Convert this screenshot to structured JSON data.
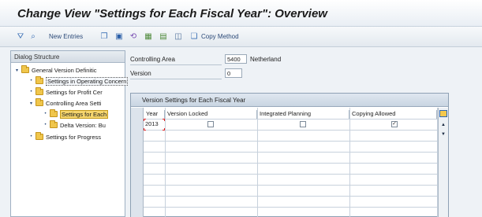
{
  "window": {
    "title": "Change View \"Settings for Each Fiscal Year\": Overview"
  },
  "toolbar": {
    "icons": [
      "filter-icon",
      "display-change-icon"
    ],
    "new_entries": "New Entries",
    "actions": [
      "copy-icon",
      "save-icon",
      "undo-icon",
      "select-all-icon",
      "select-block-icon",
      "deselect-icon"
    ],
    "copy_method": "Copy Method"
  },
  "dialog_structure": {
    "title": "Dialog Structure",
    "items": [
      {
        "label": "General Version Definitic",
        "level": 0,
        "expander": "▾"
      },
      {
        "label": "Settings in Operating Concern",
        "level": 1,
        "expander": "•"
      },
      {
        "label": "Settings for Profit Cer",
        "level": 1,
        "expander": "•"
      },
      {
        "label": "Controlling Area Setti",
        "level": 1,
        "expander": "▾"
      },
      {
        "label": "Settings for Each",
        "level": 2,
        "expander": "•"
      },
      {
        "label": "Delta Version: Bu",
        "level": 2,
        "expander": "•"
      },
      {
        "label": "Settings for Progress",
        "level": 1,
        "expander": "•"
      }
    ]
  },
  "header_fields": {
    "controlling_area": {
      "label": "Controlling Area",
      "value": "5400",
      "description": "Netherland"
    },
    "version": {
      "label": "Version",
      "value": "0"
    }
  },
  "table": {
    "title": "Version Settings for Each Fiscal Year",
    "columns": [
      "Year",
      "Version Locked",
      "Integrated Planning",
      "Copying Allowed"
    ],
    "rows": [
      {
        "year": "2013",
        "version_locked": false,
        "integrated_planning": false,
        "copying_allowed": true
      }
    ],
    "check_mark": "✓"
  },
  "colors": {
    "selected_tree_item": "#f6d66d",
    "title_text": "#1b1b1b",
    "link_text": "#2c4a78"
  }
}
